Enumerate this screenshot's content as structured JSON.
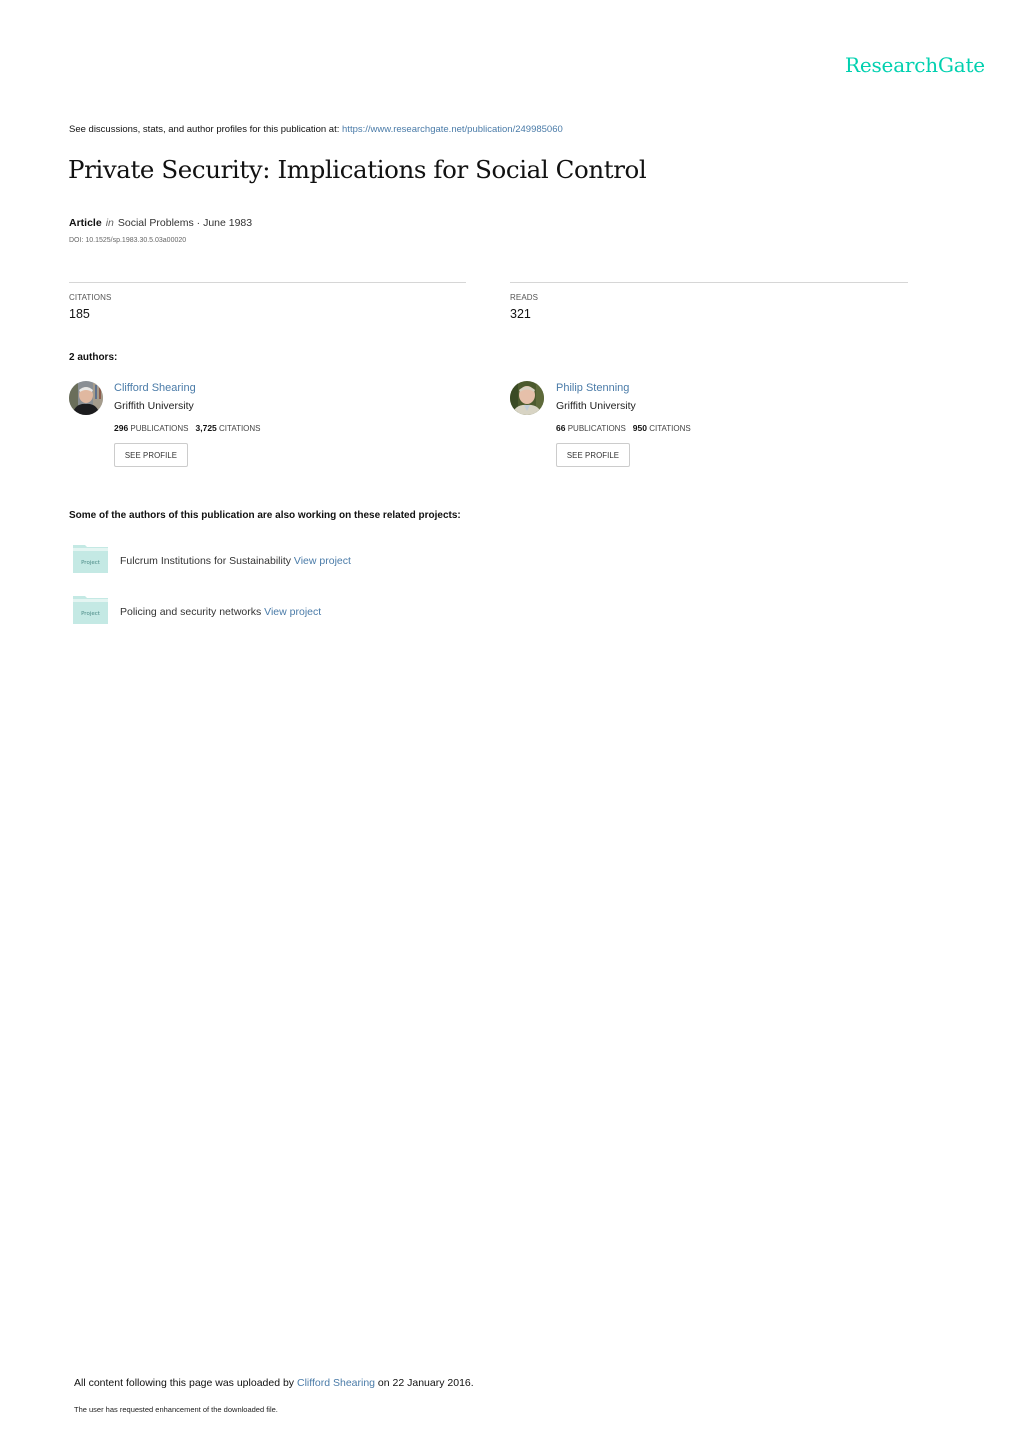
{
  "brand": {
    "logo_text": "ResearchGate",
    "accent_color": "#00d0af",
    "link_color": "#4a7ba8"
  },
  "header": {
    "see_discussions_text": "See discussions, stats, and author profiles for this publication at: ",
    "publication_url": "https://www.researchgate.net/publication/249985060"
  },
  "publication": {
    "title": "Private Security: Implications for Social Control",
    "type": "Article",
    "in_label": "in",
    "journal_date": "Social Problems · June 1983",
    "doi": "DOI: 10.1525/sp.1983.30.5.03a00020"
  },
  "stats": {
    "citations_label": "CITATIONS",
    "citations_value": "185",
    "reads_label": "READS",
    "reads_value": "321"
  },
  "authors_section": {
    "heading": "2 authors:",
    "authors": [
      {
        "name": "Clifford Shearing",
        "institution": "Griffith University",
        "publications_count": "296",
        "publications_label": "PUBLICATIONS",
        "citations_count": "3,725",
        "citations_label": "CITATIONS",
        "button_label": "SEE PROFILE"
      },
      {
        "name": "Philip Stenning",
        "institution": "Griffith University",
        "publications_count": "66",
        "publications_label": "PUBLICATIONS",
        "citations_count": "950",
        "citations_label": "CITATIONS",
        "button_label": "SEE PROFILE"
      }
    ]
  },
  "projects_section": {
    "heading": "Some of the authors of this publication are also working on these related projects:",
    "folder_label": "Project",
    "projects": [
      {
        "name": "Fulcrum Institutions for Sustainability",
        "link_label": "View project"
      },
      {
        "name": "Policing and security networks",
        "link_label": "View project"
      }
    ]
  },
  "footer": {
    "uploaded_prefix": "All content following this page was uploaded by ",
    "uploader": "Clifford Shearing",
    "uploaded_suffix": " on 22 January 2016.",
    "enhancement_note": "The user has requested enhancement of the downloaded file."
  }
}
